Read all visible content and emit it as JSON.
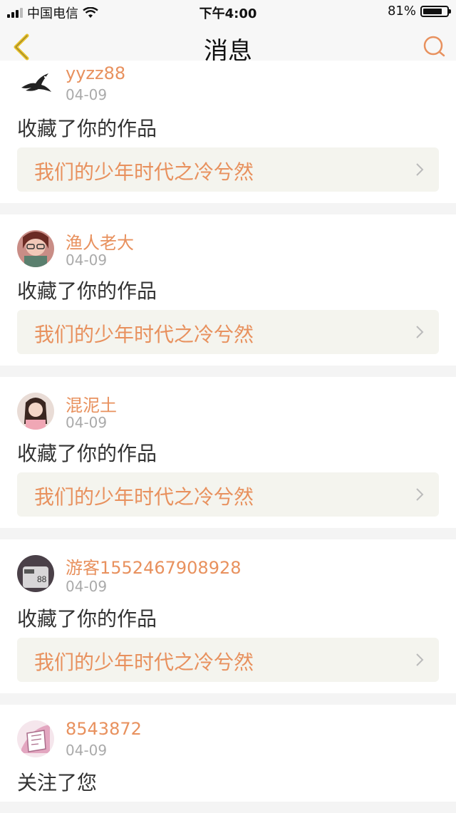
{
  "status_bar": {
    "carrier": "中国电信",
    "time": "下午4:00",
    "battery_percent": "81%",
    "battery_level": 0.81
  },
  "nav": {
    "title": "消息"
  },
  "messages": [
    {
      "username": "yyzz88",
      "date": "04-09",
      "action": "收藏了你的作品",
      "work_title": "我们的少年时代之冷兮然",
      "avatar_icon": "swallow-bird-icon"
    },
    {
      "username": "渔人老大",
      "date": "04-09",
      "action": "收藏了你的作品",
      "work_title": "我们的少年时代之冷兮然",
      "avatar_icon": "user-photo-avatar"
    },
    {
      "username": "混泥土",
      "date": "04-09",
      "action": "收藏了你的作品",
      "work_title": "我们的少年时代之冷兮然",
      "avatar_icon": "user-photo-avatar"
    },
    {
      "username": "游客1552467908928",
      "date": "04-09",
      "action": "收藏了你的作品",
      "work_title": "我们的少年时代之冷兮然",
      "avatar_icon": "user-photo-avatar"
    },
    {
      "username": "8543872",
      "date": "04-09",
      "action": "关注了您",
      "avatar_icon": "user-photo-avatar"
    }
  ],
  "colors": {
    "accent": "#e8915e",
    "back_icon": "#e8c12a",
    "card_link_bg": "#f4f4ee"
  }
}
